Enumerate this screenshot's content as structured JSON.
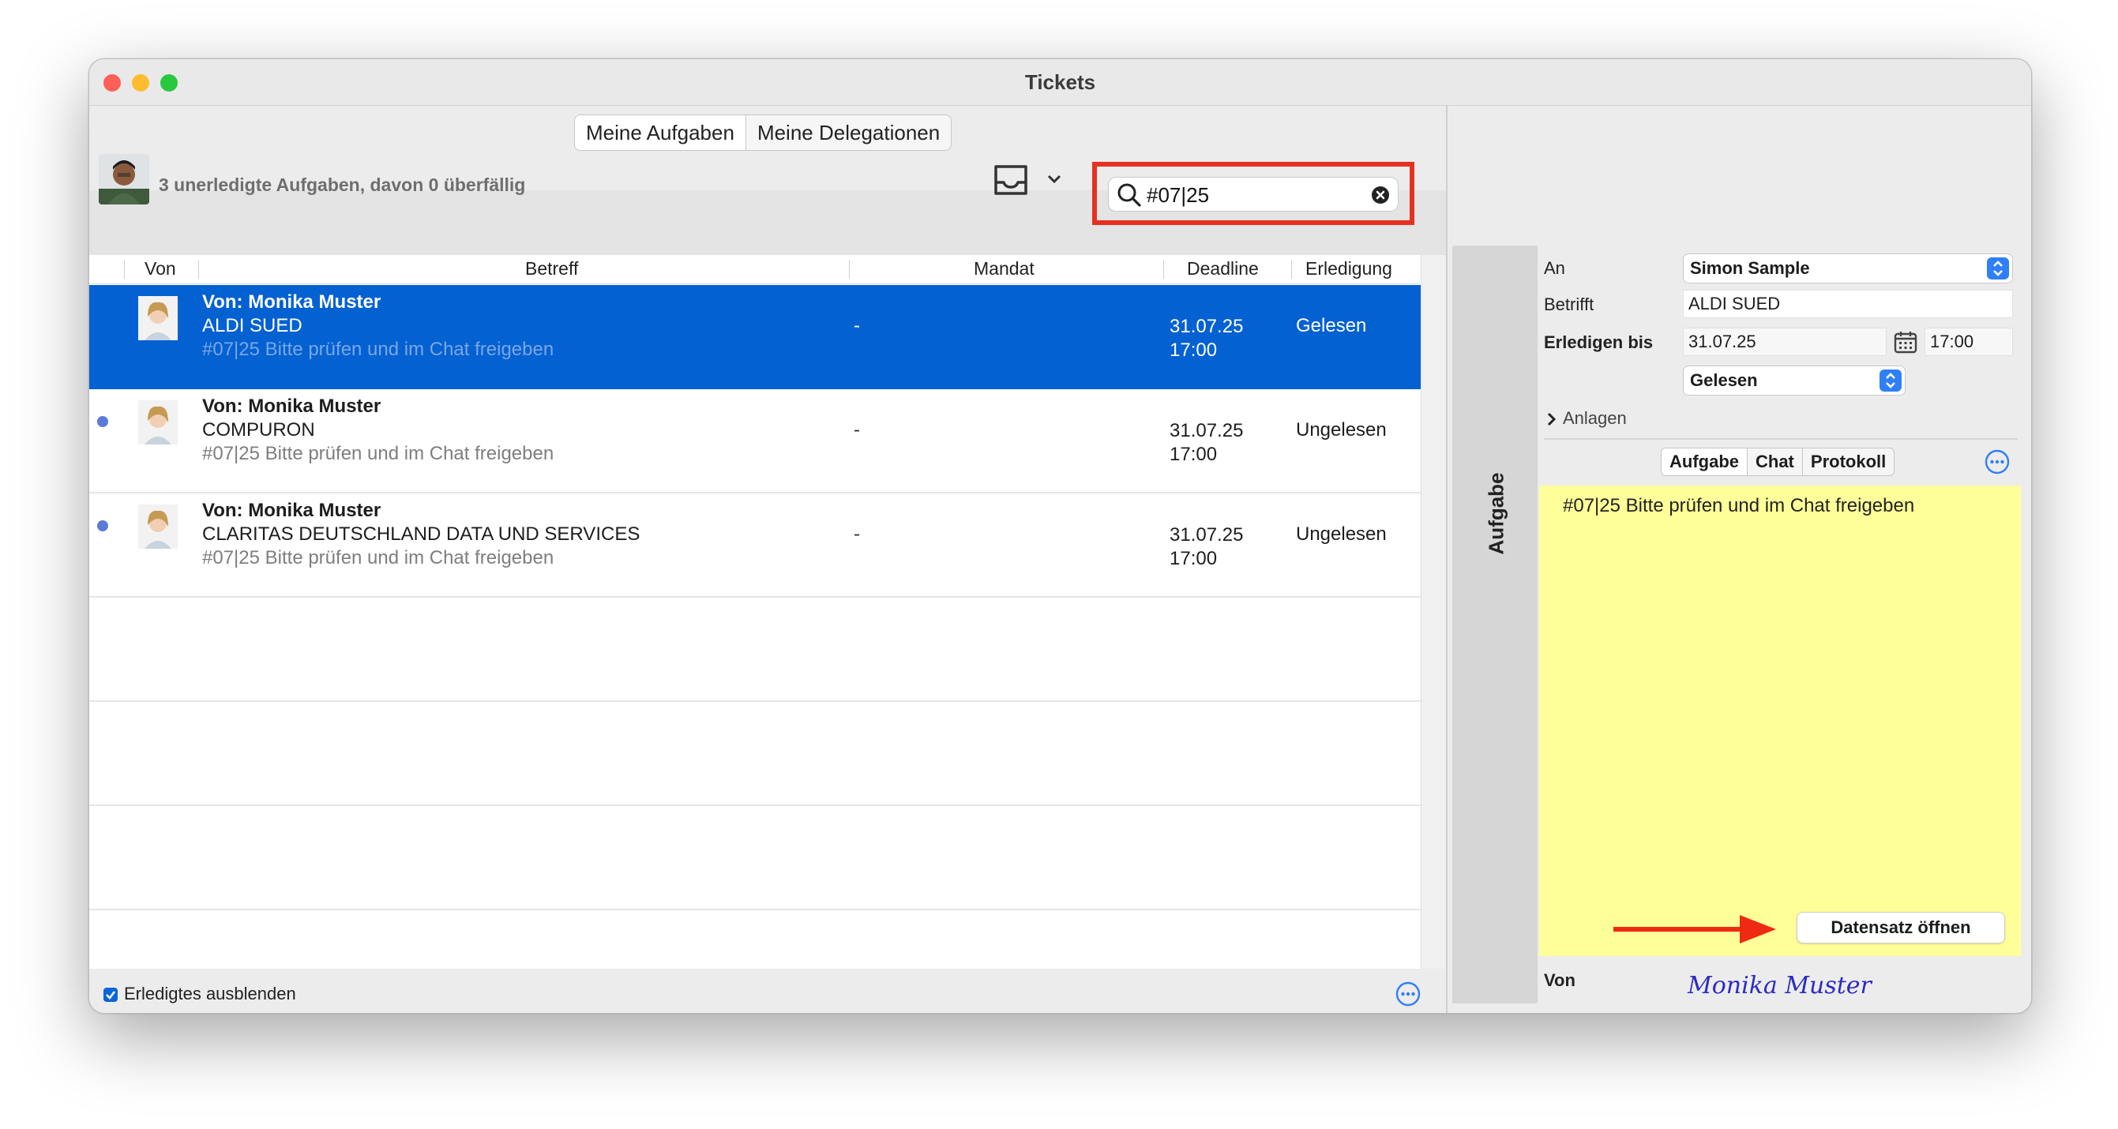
{
  "window": {
    "title": "Tickets"
  },
  "tabs": [
    {
      "label": "Meine Aufgaben",
      "active": true
    },
    {
      "label": "Meine Delegationen",
      "active": false
    }
  ],
  "summary": "3 unerledigte Aufgaben, davon 0 überfällig",
  "search": {
    "value": "#07|25"
  },
  "table": {
    "headers": {
      "von": "Von",
      "betreff": "Betreff",
      "mandat": "Mandat",
      "deadline": "Deadline",
      "erledigung": "Erledigung"
    },
    "rows": [
      {
        "from": "Von: Monika Muster",
        "subject": "ALDI SUED",
        "description": "#07|25 Bitte prüfen und im Chat freigeben",
        "mandat": "-",
        "deadline_date": "31.07.25",
        "deadline_time": "17:00",
        "status": "Gelesen",
        "selected": true,
        "unread": false
      },
      {
        "from": "Von: Monika Muster",
        "subject": "COMPURON",
        "description": "#07|25 Bitte prüfen und im Chat freigeben",
        "mandat": "-",
        "deadline_date": "31.07.25",
        "deadline_time": "17:00",
        "status": "Ungelesen",
        "selected": false,
        "unread": true
      },
      {
        "from": "Von: Monika Muster",
        "subject": "CLARITAS DEUTSCHLAND DATA UND SERVICES",
        "description": "#07|25 Bitte prüfen und im Chat freigeben",
        "mandat": "-",
        "deadline_date": "31.07.25",
        "deadline_time": "17:00",
        "status": "Ungelesen",
        "selected": false,
        "unread": true
      }
    ]
  },
  "footer": {
    "hide_done_label": "Erledigtes ausblenden",
    "hide_done_checked": true
  },
  "side_tab": {
    "label": "Aufgabe"
  },
  "detail": {
    "an_label": "An",
    "an_value": "Simon Sample",
    "betrifft_label": "Betrifft",
    "betrifft_value": "ALDI SUED",
    "erledigen_label": "Erledigen bis",
    "erledigen_date": "31.07.25",
    "erledigen_time": "17:00",
    "status_value": "Gelesen",
    "anlagen_label": "Anlagen",
    "subtabs": [
      {
        "label": "Aufgabe",
        "active": true
      },
      {
        "label": "Chat",
        "active": false
      },
      {
        "label": "Protokoll",
        "active": false
      }
    ],
    "note_text": "#07|25 Bitte prüfen und im Chat freigeben",
    "open_button": "Datensatz öffnen",
    "von_label": "Von",
    "signature": "Monika Muster"
  },
  "colors": {
    "accent": "#0361d2",
    "highlight": "#e53121",
    "note": "#ffff99",
    "unread_dot": "#5b7bd8"
  }
}
